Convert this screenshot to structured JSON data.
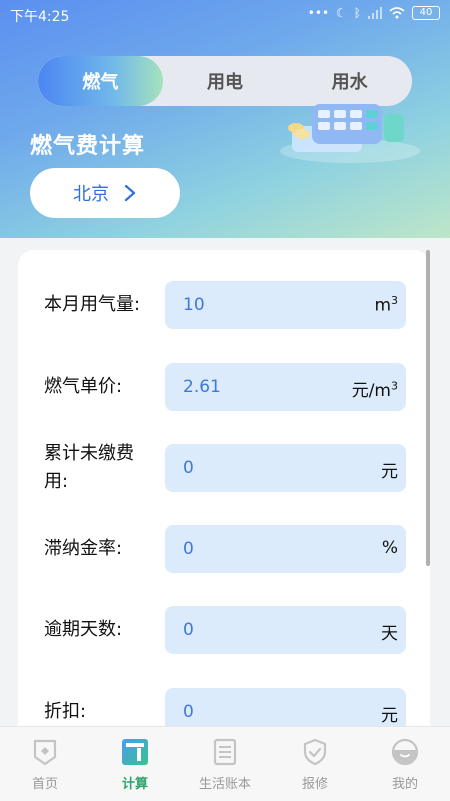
{
  "status_bar": {
    "time": "下午4:25",
    "battery": "40"
  },
  "tabs": [
    {
      "label": "燃气",
      "active": true
    },
    {
      "label": "用电",
      "active": false
    },
    {
      "label": "用水",
      "active": false
    }
  ],
  "hero": {
    "title": "燃气费计算",
    "city": "北京"
  },
  "form": {
    "rows": [
      {
        "label": "本月用气量:",
        "value": "10",
        "unit": "m",
        "unit_sup": "3"
      },
      {
        "label": "燃气单价:",
        "value": "2.61",
        "unit": "元/m",
        "unit_sup": "3"
      },
      {
        "label": "累计未缴费用:",
        "value": "0",
        "unit": "元",
        "unit_sup": ""
      },
      {
        "label": "滞纳金率:",
        "value": "0",
        "unit": "%",
        "unit_sup": ""
      },
      {
        "label": "逾期天数:",
        "value": "0",
        "unit": "天",
        "unit_sup": ""
      },
      {
        "label": "折扣:",
        "value": "0",
        "unit": "元",
        "unit_sup": ""
      }
    ]
  },
  "nav": {
    "items": [
      {
        "label": "首页",
        "icon": "home-icon"
      },
      {
        "label": "计算",
        "icon": "calculate-icon",
        "active": true
      },
      {
        "label": "生活账本",
        "icon": "ledger-icon"
      },
      {
        "label": "报修",
        "icon": "repair-icon"
      },
      {
        "label": "我的",
        "icon": "profile-icon"
      }
    ]
  },
  "colors": {
    "accent": "#3f78d8",
    "input_bg": "#dcebfc",
    "nav_active": "#2ea36d"
  }
}
